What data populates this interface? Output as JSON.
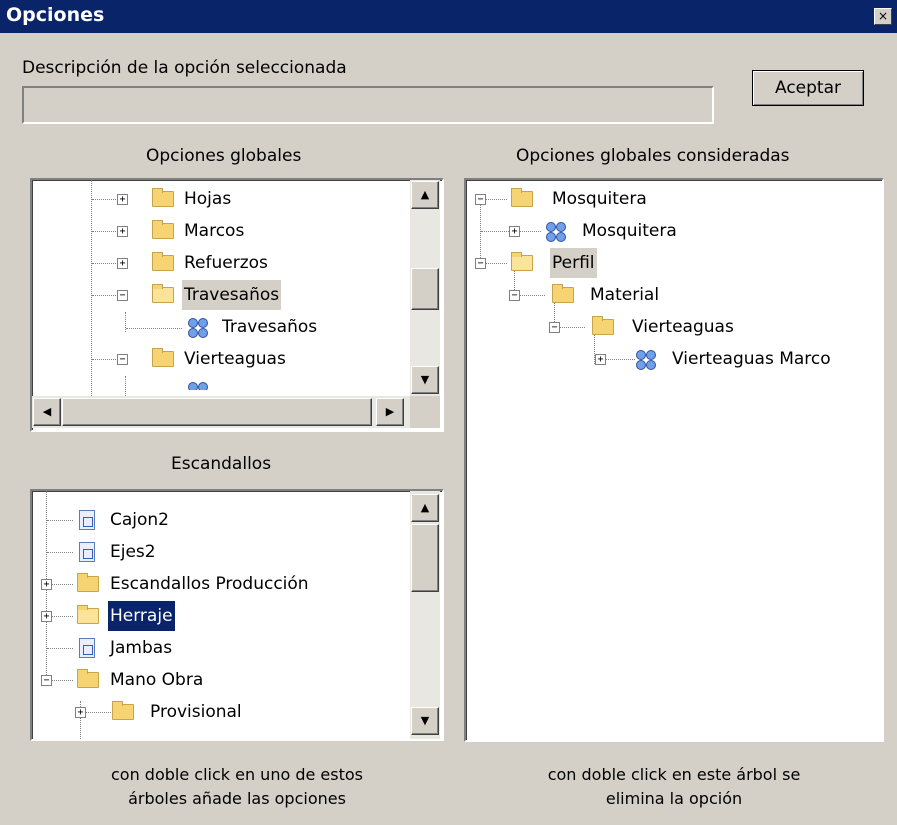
{
  "window": {
    "title": "Opciones",
    "close_glyph": "×"
  },
  "description": {
    "label": "Descripción de la opción seleccionada",
    "value": ""
  },
  "accept_button": {
    "label": "Aceptar"
  },
  "global_options": {
    "heading": "Opciones globales",
    "items": [
      "Hojas",
      "Marcos",
      "Refuerzos",
      "Travesaños",
      "Travesaños",
      "Vierteaguas"
    ],
    "selected": "Travesaños"
  },
  "escandallos": {
    "heading": "Escandallos",
    "items": [
      "Cajon2",
      "Ejes2",
      "Escandallos Producción",
      "Herraje",
      "Jambas",
      "Mano Obra",
      "Provisional"
    ],
    "selected": "Herraje"
  },
  "considered": {
    "heading": "Opciones globales consideradas",
    "items": [
      "Mosquitera",
      "Mosquitera",
      "Perfil",
      "Material",
      "Vierteaguas",
      "Vierteaguas Marco"
    ],
    "selected": "Perfil"
  },
  "footer": {
    "left_line1": "con doble click en uno de estos",
    "left_line2": "árboles añade las opciones",
    "right_line1": "con doble click en este árbol se",
    "right_line2": "elimina la opción"
  },
  "icons": {
    "folder": "folder-icon",
    "option": "option-icon",
    "document": "document-icon"
  },
  "colors": {
    "titlebar": "#0a246a",
    "window_bg": "#d4d0c8",
    "selection": "#0a246a"
  }
}
